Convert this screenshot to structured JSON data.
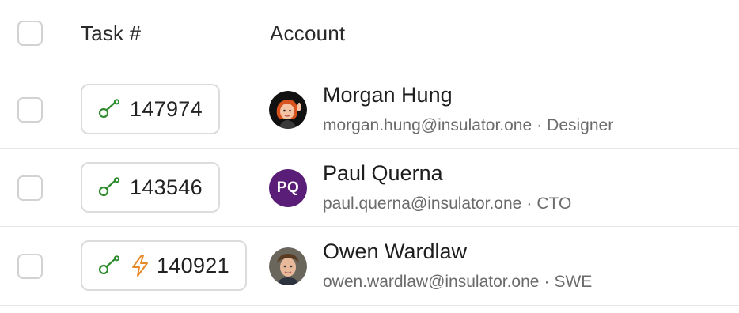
{
  "header": {
    "task_label": "Task #",
    "account_label": "Account"
  },
  "rows": [
    {
      "task": "147974",
      "task_icons": [
        "key-icon"
      ],
      "name": "Morgan Hung",
      "email": "morgan.hung@insulator.one",
      "role": "Designer",
      "avatar": "memoji-avatar"
    },
    {
      "task": "143546",
      "task_icons": [
        "key-icon"
      ],
      "name": "Paul Querna",
      "email": "paul.querna@insulator.one",
      "role": "CTO",
      "avatar_initials": "PQ"
    },
    {
      "task": "140921",
      "task_icons": [
        "key-icon",
        "lightning-icon"
      ],
      "name": "Owen Wardlaw",
      "email": "owen.wardlaw@insulator.one",
      "role": "SWE",
      "avatar": "photo-avatar"
    }
  ],
  "separator": "·",
  "colors": {
    "key_icon": "#2e8b2e",
    "lightning_icon": "#e8892a",
    "initials_avatar_bg": "#5a1e78",
    "border": "#dcdcdc"
  }
}
